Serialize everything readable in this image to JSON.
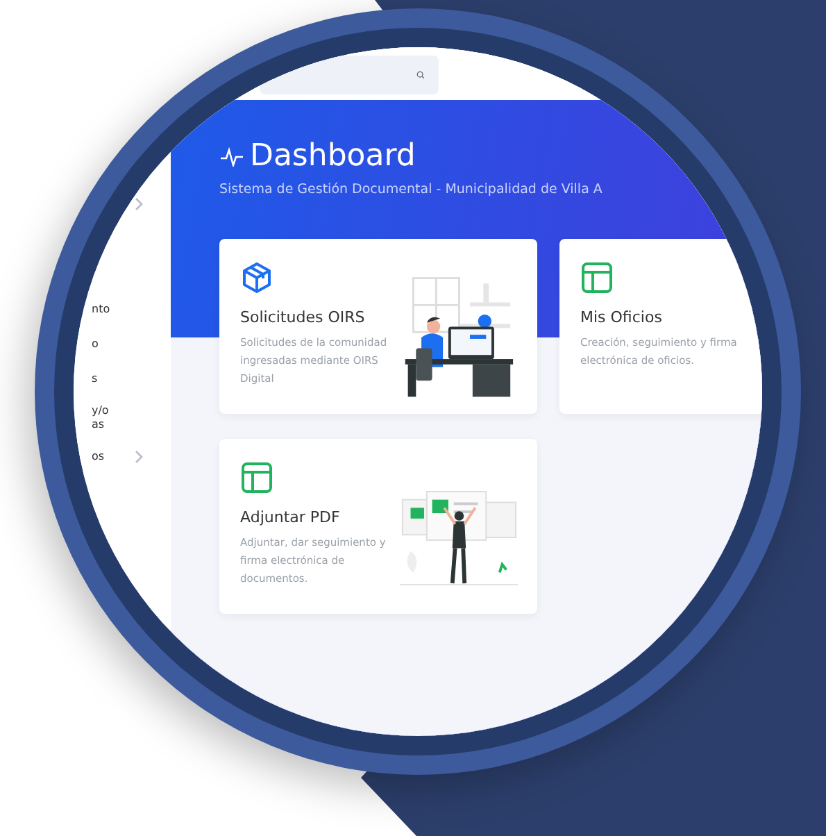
{
  "sidebar": {
    "items": [
      {
        "expandable": true
      },
      {
        "label": "nto",
        "expandable": false
      },
      {
        "label": "o",
        "expandable": false
      },
      {
        "label": "s",
        "expandable": false
      },
      {
        "label": "y/o\nas",
        "expandable": false
      },
      {
        "label": "os",
        "expandable": true
      }
    ]
  },
  "header": {
    "title": "Dashboard",
    "subtitle": "Sistema de Gestión Documental - Municipalidad de Villa A"
  },
  "cards": [
    {
      "kind": "requests",
      "title": "Solicitudes OIRS",
      "description": "Solicitudes de la comunidad ingresadas mediante OIRS Digital"
    },
    {
      "kind": "plain",
      "title": "Mis Oficios",
      "description": "Creación, seguimiento y firma electrónica de oficios."
    },
    {
      "kind": "upload",
      "title": "Adjuntar PDF",
      "description": "Adjuntar, dar seguimiento y firma electrónica de documentos."
    }
  ]
}
